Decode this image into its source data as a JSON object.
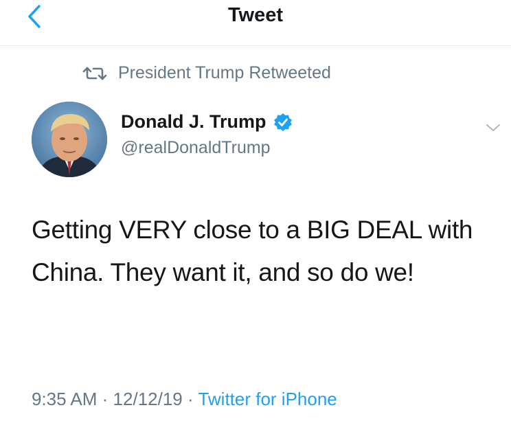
{
  "header": {
    "title": "Tweet",
    "back_icon": "chevron-left-icon",
    "accent": "#1da1f2"
  },
  "retweet": {
    "icon": "retweet-icon",
    "label": "President Trump Retweeted"
  },
  "author": {
    "name": "Donald J. Trump",
    "verified_icon": "verified-badge-icon",
    "handle": "@realDonaldTrump"
  },
  "tweet": {
    "text": "Getting VERY close to a BIG DEAL with China. They want it, and so do we!"
  },
  "meta": {
    "time": "9:35 AM",
    "separator": "·",
    "date": "12/12/19",
    "source": "Twitter for iPhone"
  }
}
